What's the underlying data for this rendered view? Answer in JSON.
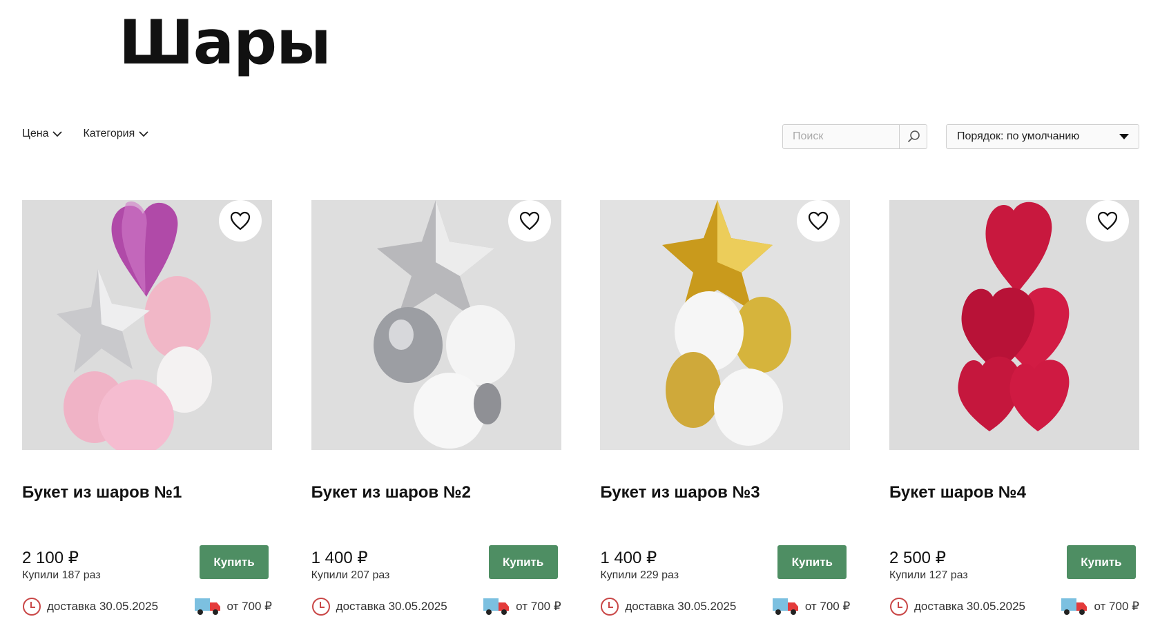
{
  "page": {
    "title": "Шары"
  },
  "filters": [
    {
      "label": "Цена"
    },
    {
      "label": "Категория"
    }
  ],
  "search": {
    "placeholder": "Поиск",
    "icon": "search-icon"
  },
  "sort": {
    "label": "Порядок: по умолчанию"
  },
  "colors": {
    "buy_button": "#4e8e63",
    "clock": "#c94747"
  },
  "products": [
    {
      "title": "Букет из шаров №1",
      "price": "2 100 ₽",
      "bought": "Купили 187 раз",
      "buy_label": "Купить",
      "delivery": "доставка 30.05.2025",
      "shipping": "от 700 ₽"
    },
    {
      "title": "Букет из шаров №2",
      "price": "1 400 ₽",
      "bought": "Купили 207 раз",
      "buy_label": "Купить",
      "delivery": "доставка 30.05.2025",
      "shipping": "от 700 ₽"
    },
    {
      "title": "Букет из шаров №3",
      "price": "1 400 ₽",
      "bought": "Купили 229 раз",
      "buy_label": "Купить",
      "delivery": "доставка 30.05.2025",
      "shipping": "от 700 ₽"
    },
    {
      "title": "Букет шаров №4",
      "price": "2 500 ₽",
      "bought": "Купили 127 раз",
      "buy_label": "Купить",
      "delivery": "доставка 30.05.2025",
      "shipping": "от 700 ₽"
    }
  ]
}
